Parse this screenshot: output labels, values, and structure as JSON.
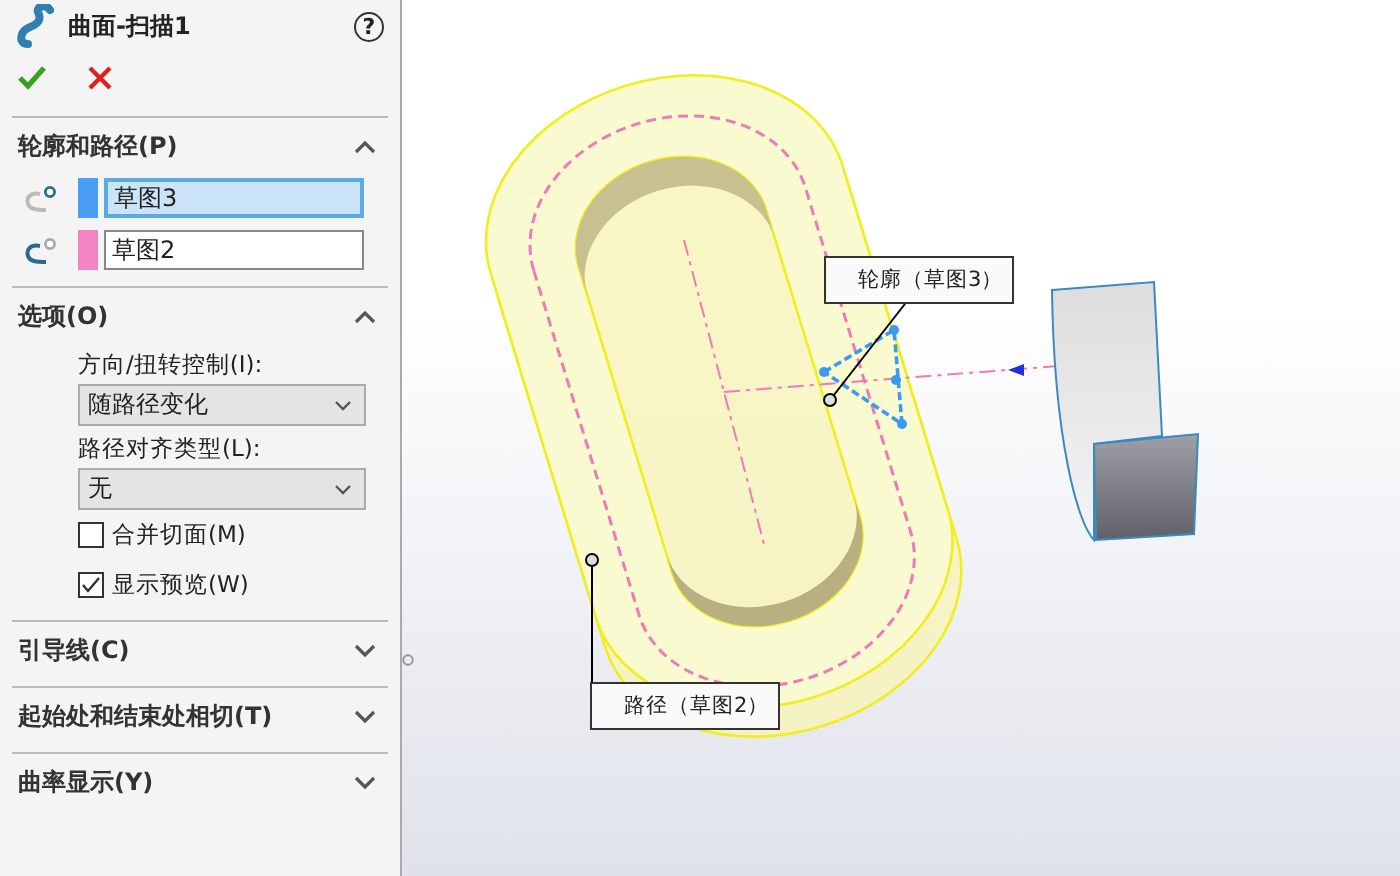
{
  "panel": {
    "title": "曲面-扫描1",
    "help": "?"
  },
  "sections": [
    {
      "kind": "selections",
      "title": "轮廓和路径(P)",
      "expanded": true,
      "items": [
        {
          "label": "草图3",
          "color": "#4a9ff5",
          "selected": true
        },
        {
          "label": "草图2",
          "color": "#f584c4",
          "selected": false
        }
      ]
    },
    {
      "kind": "options",
      "title": "选项(O)",
      "expanded": true,
      "items": [
        {
          "kind": "label",
          "text": "方向/扭转控制(I):"
        },
        {
          "kind": "dropdown",
          "value": "随路径变化"
        },
        {
          "kind": "label",
          "text": "路径对齐类型(L):"
        },
        {
          "kind": "dropdown",
          "value": "无"
        },
        {
          "kind": "checkbox",
          "text": "合并切面(M)",
          "checked": false
        },
        {
          "kind": "checkbox",
          "text": "显示预览(W)",
          "checked": true
        }
      ]
    },
    {
      "title": "引导线(C)",
      "expanded": false
    },
    {
      "title": "起始处和结束处相切(T)",
      "expanded": false
    },
    {
      "title": "曲率显示(Y)",
      "expanded": false
    }
  ],
  "viewport": {
    "callouts": [
      {
        "text": "轮廓（草图3）"
      },
      {
        "text": "路径（草图2）"
      }
    ]
  }
}
